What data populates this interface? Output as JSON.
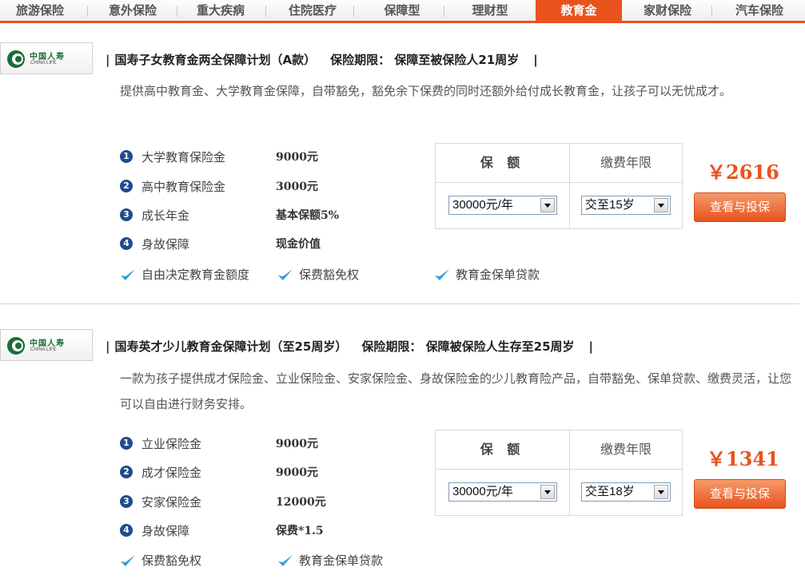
{
  "nav": {
    "items": [
      {
        "label": "旅游保险"
      },
      {
        "label": "意外保险"
      },
      {
        "label": "重大疾病"
      },
      {
        "label": "住院医疗"
      },
      {
        "label": "保障型"
      },
      {
        "label": "理财型"
      },
      {
        "label": "教育金",
        "active": true
      },
      {
        "label": "家财保险"
      },
      {
        "label": "汽车保险"
      }
    ]
  },
  "colors": {
    "accent": "#e8531d",
    "brand_green": "#1a6d35",
    "bullet_blue": "#1f4b8e"
  },
  "products": [
    {
      "logo_cn": "中国人寿",
      "logo_en": "CHINA LIFE",
      "title": "国寿子女教育金两全保障计划（A款）",
      "period_label": "保险期限：",
      "period_value": "保障至被保险人21周岁",
      "description": "提供高中教育金、大学教育金保障，自带豁免，豁免余下保费的同时还额外给付成长教育金，让孩子可以无忧成才。",
      "benefits": [
        {
          "num": "1",
          "label": "大学教育保险金",
          "value": "9000元"
        },
        {
          "num": "2",
          "label": "高中教育保险金",
          "value": "3000元"
        },
        {
          "num": "3",
          "label": "成长年金",
          "value": "基本保额5%"
        },
        {
          "num": "4",
          "label": "身故保障",
          "value": "现金价值"
        }
      ],
      "features": [
        "自由决定教育金额度",
        "保费豁免权",
        "教育金保单贷款"
      ],
      "col_amount": "保 额",
      "col_term": "缴费年限",
      "amount_selected": "30000元/年",
      "term_selected": "交至15岁",
      "price": "￥2616",
      "buy_label": "查看与投保"
    },
    {
      "logo_cn": "中国人寿",
      "logo_en": "CHINA LIFE",
      "title": "国寿英才少儿教育金保障计划（至25周岁）",
      "period_label": "保险期限：",
      "period_value": "保障被保险人生存至25周岁",
      "description": "一款为孩子提供成才保险金、立业保险金、安家保险金、身故保险金的少儿教育险产品，自带豁免、保单贷款、缴费灵活，让您可以自由进行财务安排。",
      "benefits": [
        {
          "num": "1",
          "label": "立业保险金",
          "value": "9000元"
        },
        {
          "num": "2",
          "label": "成才保险金",
          "value": "9000元"
        },
        {
          "num": "3",
          "label": "安家保险金",
          "value": "12000元"
        },
        {
          "num": "4",
          "label": "身故保障",
          "value": "保费*1.5"
        }
      ],
      "features": [
        "保费豁免权",
        "教育金保单贷款"
      ],
      "col_amount": "保 额",
      "col_term": "缴费年限",
      "amount_selected": "30000元/年",
      "term_selected": "交至18岁",
      "price": "￥1341",
      "buy_label": "查看与投保"
    }
  ]
}
